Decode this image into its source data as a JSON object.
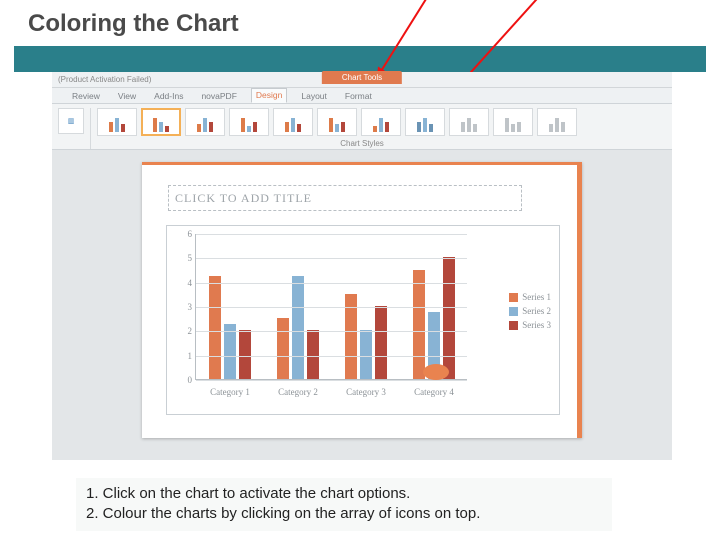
{
  "slide_title": "Coloring the Chart",
  "office": {
    "activation": "(Product Activation Failed)",
    "chart_tools": "Chart Tools",
    "tabs": [
      "Review",
      "View",
      "Add-Ins",
      "novaPDF",
      "Design",
      "Layout",
      "Format"
    ],
    "active_tab_index": 4,
    "styles_label": "Chart Styles"
  },
  "slide": {
    "placeholder": "CLICK TO ADD TITLE"
  },
  "legend": {
    "s1": "Series 1",
    "s2": "Series 2",
    "s3": "Series 3"
  },
  "chart_data": {
    "type": "bar",
    "title": "",
    "xlabel": "",
    "ylabel": "",
    "ylim": [
      0,
      6
    ],
    "yticks": [
      0,
      1,
      2,
      3,
      4,
      5,
      6
    ],
    "categories": [
      "Category 1",
      "Category 2",
      "Category 3",
      "Category 4"
    ],
    "series": [
      {
        "name": "Series 1",
        "values": [
          4.25,
          2.5,
          3.5,
          4.5
        ]
      },
      {
        "name": "Series 2",
        "values": [
          2.25,
          4.25,
          2.0,
          2.75
        ]
      },
      {
        "name": "Series 3",
        "values": [
          2.0,
          2.0,
          3.0,
          5.0
        ]
      }
    ],
    "legend_position": "right",
    "grid": true
  },
  "instructions": {
    "line1": "1. Click on the chart to activate the chart options.",
    "line2": "2. Colour the charts by clicking on the array of icons on top."
  }
}
